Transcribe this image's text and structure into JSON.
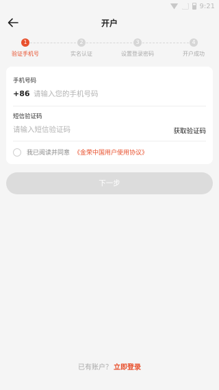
{
  "status_bar": {
    "time": "9:21"
  },
  "header": {
    "title": "开户"
  },
  "steps": [
    {
      "num": "1",
      "label": "验证手机号",
      "active": true
    },
    {
      "num": "2",
      "label": "实名认证",
      "active": false
    },
    {
      "num": "3",
      "label": "设置登录密码",
      "active": false
    },
    {
      "num": "4",
      "label": "开户成功",
      "active": false
    }
  ],
  "form": {
    "phone_label": "手机号码",
    "phone_prefix": "+86",
    "phone_placeholder": "请输入您的手机号码",
    "sms_label": "短信验证码",
    "sms_placeholder": "请输入短信验证码",
    "get_code": "获取验证码",
    "agree_text": "我已阅读并同意",
    "agreement_link": "《金荣中国用户使用协议》"
  },
  "next_button": "下一步",
  "footer": {
    "question": "已有账户？",
    "login_link": "立即登录"
  },
  "colors": {
    "accent": "#e8512e",
    "disabled_button": "#dcdcdc",
    "background": "#f5f5f5"
  },
  "icons": {
    "back": "arrow-left-icon"
  }
}
